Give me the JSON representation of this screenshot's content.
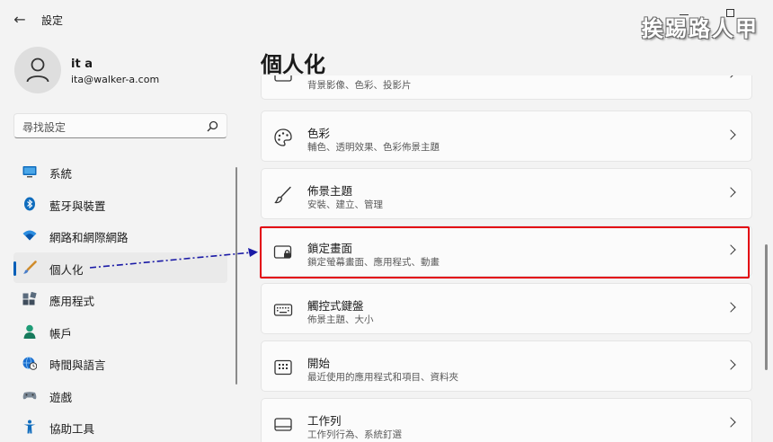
{
  "window": {
    "title": "設定",
    "watermark": "挨踢路人甲"
  },
  "profile": {
    "name": "it a",
    "email": "ita@walker-a.com"
  },
  "search": {
    "placeholder": "尋找設定"
  },
  "nav": {
    "items": [
      {
        "label": "系統",
        "icon": "monitor-icon"
      },
      {
        "label": "藍牙與裝置",
        "icon": "bluetooth-icon"
      },
      {
        "label": "網路和網際網路",
        "icon": "wifi-icon"
      },
      {
        "label": "個人化",
        "icon": "brush-icon",
        "selected": true
      },
      {
        "label": "應用程式",
        "icon": "apps-icon"
      },
      {
        "label": "帳戶",
        "icon": "person-icon"
      },
      {
        "label": "時間與語言",
        "icon": "clock-globe-icon"
      },
      {
        "label": "遊戲",
        "icon": "gamepad-icon"
      },
      {
        "label": "協助工具",
        "icon": "accessibility-icon"
      }
    ]
  },
  "main": {
    "title": "個人化",
    "cards": [
      {
        "title": "",
        "subtitle": "背景影像、色彩、投影片",
        "icon": "background-icon"
      },
      {
        "title": "色彩",
        "subtitle": "輔色、透明效果、色彩佈景主題",
        "icon": "palette-icon"
      },
      {
        "title": "佈景主題",
        "subtitle": "安裝、建立、管理",
        "icon": "brush-icon"
      },
      {
        "title": "鎖定畫面",
        "subtitle": "鎖定螢幕畫面、應用程式、動畫",
        "icon": "lock-screen-icon",
        "highlighted": true
      },
      {
        "title": "觸控式鍵盤",
        "subtitle": "佈景主題、大小",
        "icon": "keyboard-icon"
      },
      {
        "title": "開始",
        "subtitle": "最近使用的應用程式和項目、資料夾",
        "icon": "start-icon"
      },
      {
        "title": "工作列",
        "subtitle": "工作列行為、系統釘選",
        "icon": "taskbar-icon"
      }
    ]
  },
  "colors": {
    "accent": "#005fb8",
    "highlight": "#e3000f",
    "arrow": "#1a1aa6"
  }
}
